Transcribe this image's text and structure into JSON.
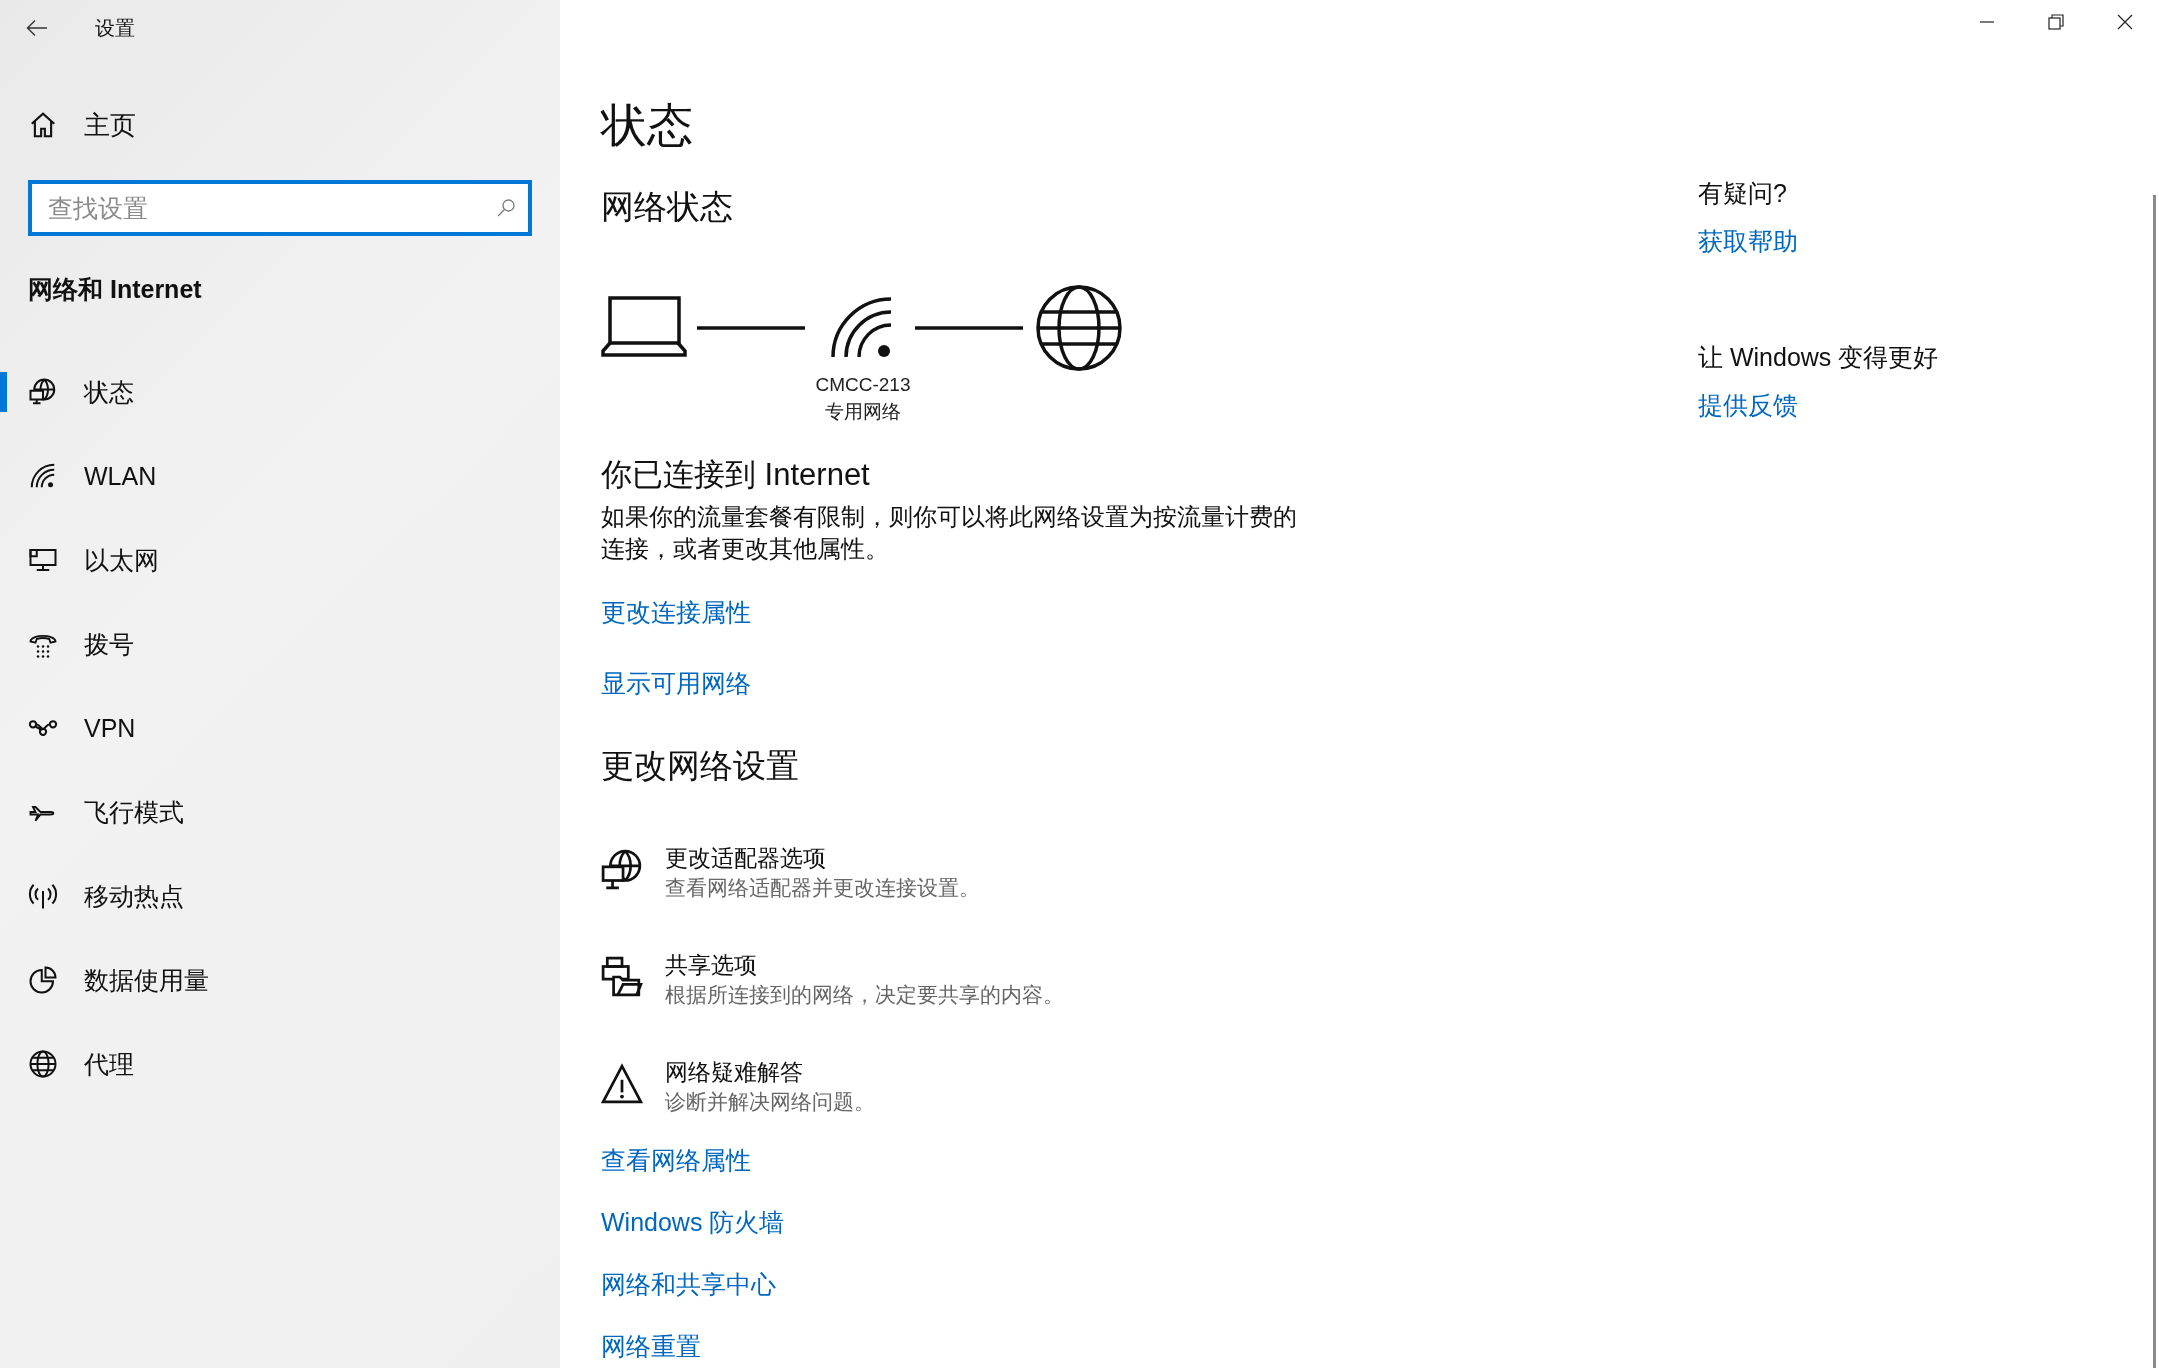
{
  "window": {
    "title": "设置"
  },
  "sidebar": {
    "home": "主页",
    "search": {
      "placeholder": "查找设置"
    },
    "section_title": "网络和 Internet",
    "items": [
      {
        "label": "状态",
        "kind": "status",
        "selected": true
      },
      {
        "label": "WLAN",
        "kind": "wlan",
        "selected": false
      },
      {
        "label": "以太网",
        "kind": "ethernet",
        "selected": false
      },
      {
        "label": "拨号",
        "kind": "dialup",
        "selected": false
      },
      {
        "label": "VPN",
        "kind": "vpn",
        "selected": false
      },
      {
        "label": "飞行模式",
        "kind": "airplane",
        "selected": false
      },
      {
        "label": "移动热点",
        "kind": "hotspot",
        "selected": false
      },
      {
        "label": "数据使用量",
        "kind": "data",
        "selected": false
      },
      {
        "label": "代理",
        "kind": "proxy",
        "selected": false
      }
    ]
  },
  "main": {
    "title": "状态",
    "network_status": {
      "heading": "网络状态",
      "network_name": "CMCC-213",
      "network_type": "专用网络"
    },
    "connection": {
      "heading": "你已连接到 Internet",
      "description": "如果你的流量套餐有限制，则你可以将此网络设置为按流量计费的连接，或者更改其他属性。",
      "links": [
        "更改连接属性",
        "显示可用网络"
      ]
    },
    "change_settings": {
      "heading": "更改网络设置",
      "options": [
        {
          "kind": "adapter",
          "title": "更改适配器选项",
          "description": "查看网络适配器并更改连接设置。"
        },
        {
          "kind": "sharing",
          "title": "共享选项",
          "description": "根据所连接到的网络，决定要共享的内容。"
        },
        {
          "kind": "troubleshoot",
          "title": "网络疑难解答",
          "description": "诊断并解决网络问题。"
        }
      ],
      "links": [
        "查看网络属性",
        "Windows 防火墙",
        "网络和共享中心",
        "网络重置"
      ]
    }
  },
  "aside": [
    {
      "heading": "有疑问?",
      "link": "获取帮助"
    },
    {
      "heading": "让 Windows 变得更好",
      "link": "提供反馈"
    }
  ]
}
